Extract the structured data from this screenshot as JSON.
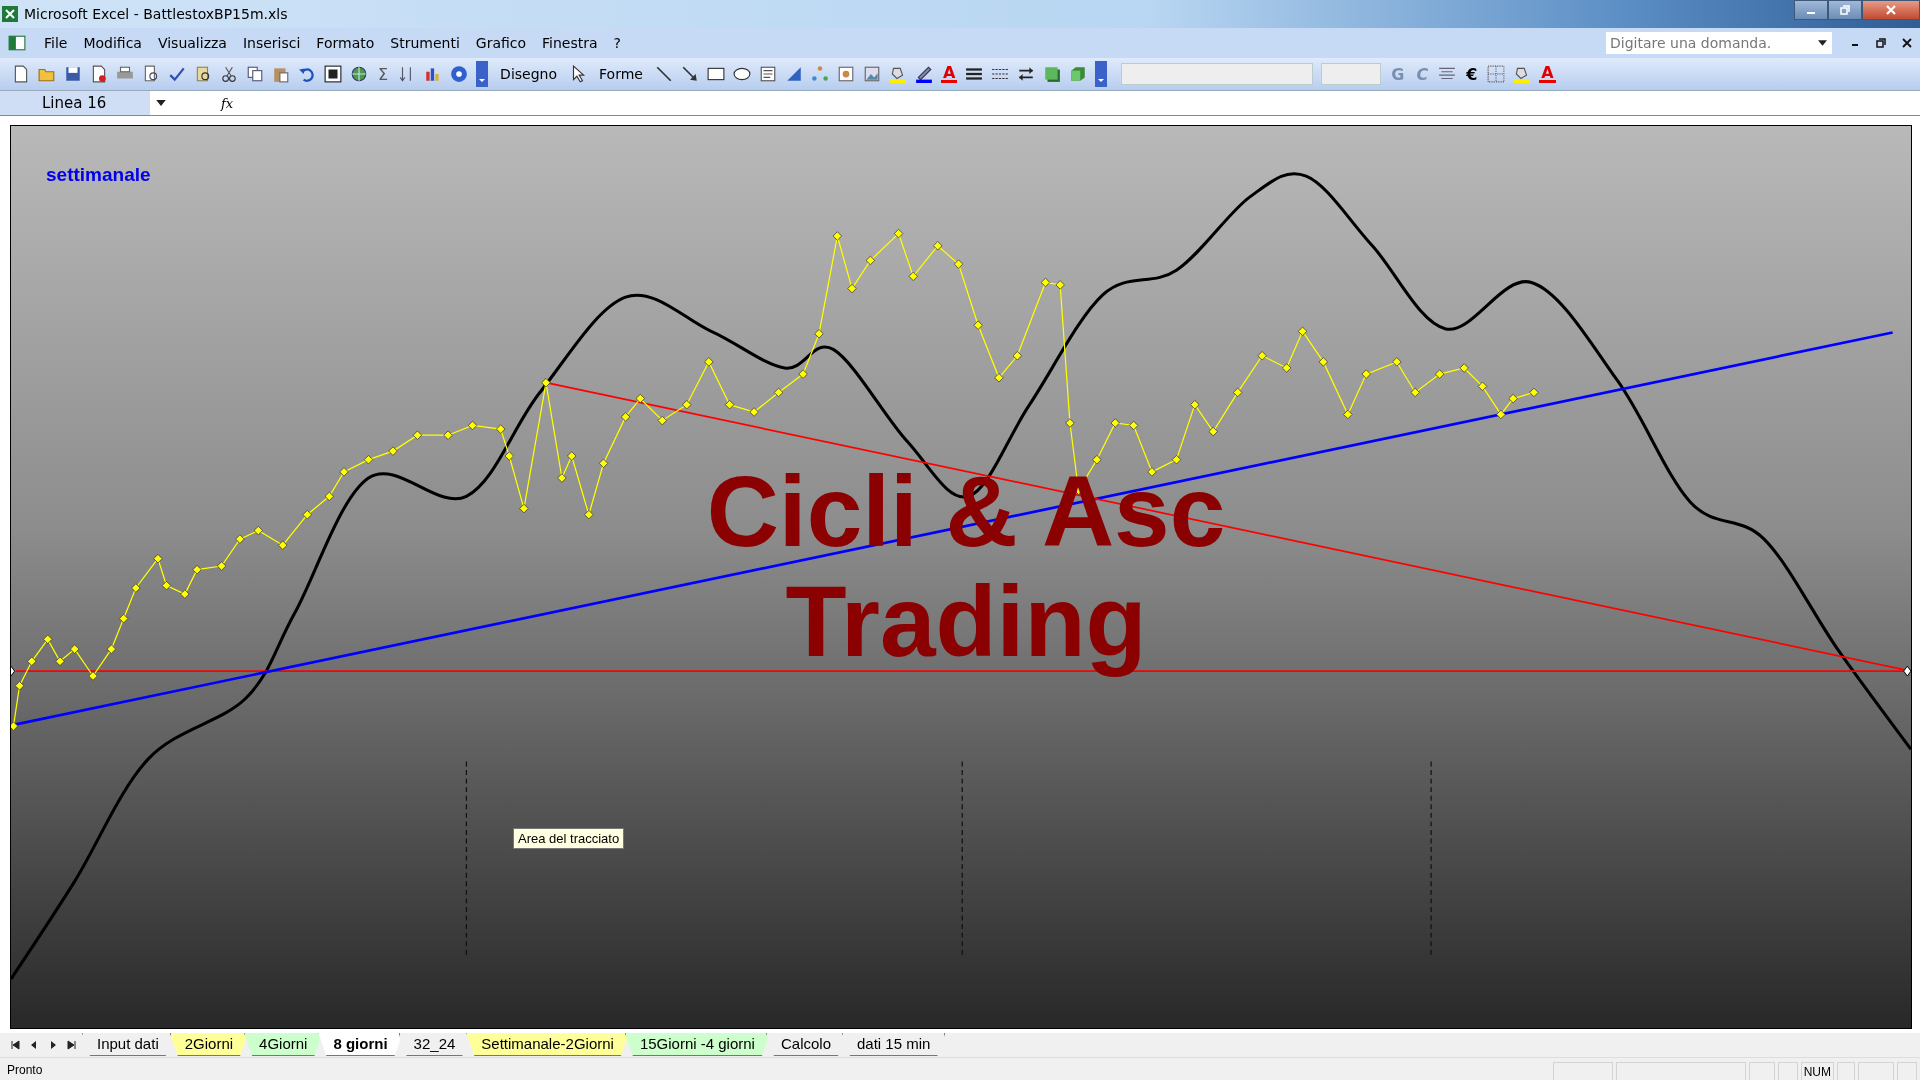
{
  "window": {
    "title": "Microsoft Excel - BattlestoxBP15m.xls"
  },
  "menu": [
    "File",
    "Modifica",
    "Visualizza",
    "Inserisci",
    "Formato",
    "Strumenti",
    "Grafico",
    "Finestra",
    "?"
  ],
  "help_search": {
    "placeholder": "Digitare una domanda."
  },
  "toolbar": {
    "sum_glyph": "Σ",
    "draw_menu": "Disegno",
    "shapes_menu": "Forme",
    "font_color_glyph": "A",
    "bold": "G",
    "italic": "C",
    "euro_glyph": "€",
    "font_color_glyph_2": "A"
  },
  "formula_bar": {
    "name_box": "Linea 16",
    "fx": "fx"
  },
  "chart": {
    "title": "settimanale",
    "overlay": [
      "Cicli & Asc",
      "Trading"
    ],
    "tooltip": "Area del tracciato"
  },
  "sheet_tabs": [
    {
      "label": "Input dati",
      "color": "#f0f0f0",
      "selected": false
    },
    {
      "label": "2Giorni",
      "color": "#ffff99",
      "selected": false
    },
    {
      "label": "4Giorni",
      "color": "#ccffcc",
      "selected": false
    },
    {
      "label": "8 giorni",
      "color": "#ffffff",
      "selected": true
    },
    {
      "label": "32_24",
      "color": "#f0f0f0",
      "selected": false
    },
    {
      "label": "Settimanale-2Giorni",
      "color": "#ffff99",
      "selected": false
    },
    {
      "label": "15Giorni -4 giorni",
      "color": "#ccffcc",
      "selected": false
    },
    {
      "label": "Calcolo",
      "color": "#f0f0f0",
      "selected": false
    },
    {
      "label": "dati 15 min",
      "color": "#f0f0f0",
      "selected": false
    }
  ],
  "status_bar": {
    "text": "Pronto",
    "indicators": [
      "NUM"
    ]
  }
}
